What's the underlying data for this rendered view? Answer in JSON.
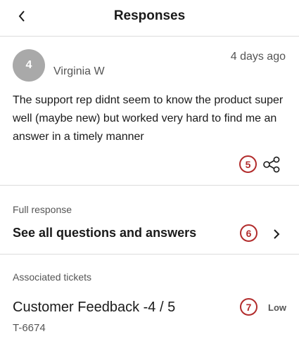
{
  "header": {
    "title": "Responses",
    "back_icon": "chevron-left-icon"
  },
  "response": {
    "avatar_text": "4",
    "author": "Virginia W",
    "time": "4 days ago",
    "comment": "The support rep didnt seem to know the product super well (maybe new) but worked very hard to find me an answer in a timely manner",
    "badge": "5",
    "share_icon": "share-icon"
  },
  "full_response": {
    "label": "Full response",
    "title": "See all questions and answers",
    "badge": "6",
    "chevron_icon": "chevron-right-icon"
  },
  "tickets": {
    "label": "Associated tickets",
    "title": "Customer Feedback -4 / 5",
    "id": "T-6674",
    "priority": "Low",
    "badge": "7"
  },
  "colors": {
    "badge": "#b22c2c",
    "avatar": "#a9a9a9",
    "divider": "#dcdcdc"
  }
}
